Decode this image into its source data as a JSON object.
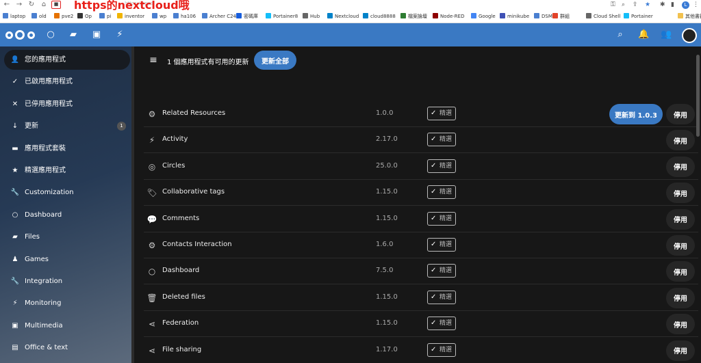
{
  "annotation_text": "https的nextcloud哦",
  "browser": {
    "url": "https://apps",
    "bookmarks": [
      {
        "label": "laptop",
        "color": "#4a7fd0"
      },
      {
        "label": "old",
        "color": "#4a7fd0"
      },
      {
        "label": "pve2",
        "color": "#e57200"
      },
      {
        "label": "Op",
        "color": "#333333"
      },
      {
        "label": "pi",
        "color": "#4a7fd0"
      },
      {
        "label": "inventor",
        "color": "#f0b400"
      },
      {
        "label": "wp",
        "color": "#4a7fd0"
      },
      {
        "label": "ha106",
        "color": "#4a7fd0"
      },
      {
        "label": "Archer C24",
        "color": "#4a7fd0"
      },
      {
        "label": "密碼庫",
        "color": "#175ddc"
      },
      {
        "label": "Portainer8",
        "color": "#13bef9"
      },
      {
        "label": "Hub",
        "color": "#666666"
      },
      {
        "label": "Nextcloud",
        "color": "#0082c9"
      },
      {
        "label": "cloud8888",
        "color": "#0082c9"
      },
      {
        "label": "檔案論壇",
        "color": "#2e7d32"
      },
      {
        "label": "Node-RED",
        "color": "#8f0000"
      },
      {
        "label": "Google",
        "color": "#4285f4"
      },
      {
        "label": "minikube",
        "color": "#3f51b5"
      },
      {
        "label": "DSM",
        "color": "#4a7fd0"
      },
      {
        "label": "群組",
        "color": "#e24329"
      },
      {
        "label": "Cloud Shell",
        "color": "#666666"
      },
      {
        "label": "Portainer",
        "color": "#13bef9"
      },
      {
        "label": "其他書籤",
        "color": "#f2c14e"
      }
    ]
  },
  "header": {
    "icons": [
      "nextcloud-logo",
      "dashboard-icon",
      "files-icon",
      "photos-icon",
      "activity-icon",
      "search-icon",
      "notifications-icon",
      "contacts-icon",
      "avatar"
    ]
  },
  "sidebar": {
    "items": [
      {
        "label": "您的應用程式",
        "icon": "user-icon",
        "glyph": "👤",
        "active": true
      },
      {
        "label": "已啟用應用程式",
        "icon": "check-icon",
        "glyph": "✓"
      },
      {
        "label": "已停用應用程式",
        "icon": "close-icon",
        "glyph": "✕"
      },
      {
        "label": "更新",
        "icon": "download-icon",
        "glyph": "↓",
        "badge": "1"
      },
      {
        "label": "應用程式套裝",
        "icon": "archive-icon",
        "glyph": "▬"
      },
      {
        "label": "精選應用程式",
        "icon": "star-icon",
        "glyph": "★"
      },
      {
        "label": "Customization",
        "icon": "wrench-icon",
        "glyph": "🔧"
      },
      {
        "label": "Dashboard",
        "icon": "circle-icon",
        "glyph": "○"
      },
      {
        "label": "Files",
        "icon": "folder-icon",
        "glyph": "▰"
      },
      {
        "label": "Games",
        "icon": "games-icon",
        "glyph": "♟"
      },
      {
        "label": "Integration",
        "icon": "wrench-icon",
        "glyph": "🔧"
      },
      {
        "label": "Monitoring",
        "icon": "activity-icon",
        "glyph": "⚡"
      },
      {
        "label": "Multimedia",
        "icon": "image-icon",
        "glyph": "▣"
      },
      {
        "label": "Office & text",
        "icon": "document-icon",
        "glyph": "▤"
      }
    ]
  },
  "main": {
    "update_summary": "1 個應用程式有可用的更新",
    "update_all_label": "更新全部",
    "featured_label": "精選",
    "disable_label": "停用",
    "apps": [
      {
        "name": "Related Resources",
        "version": "1.0.0",
        "icon": "gear-icon",
        "glyph": "⚙",
        "update_label": "更新到 1.0.3"
      },
      {
        "name": "Activity",
        "version": "2.17.0",
        "icon": "activity-icon",
        "glyph": "⚡"
      },
      {
        "name": "Circles",
        "version": "25.0.0",
        "icon": "circles-icon",
        "glyph": "◎"
      },
      {
        "name": "Collaborative tags",
        "version": "1.15.0",
        "icon": "tag-icon",
        "glyph": "🏷"
      },
      {
        "name": "Comments",
        "version": "1.15.0",
        "icon": "comment-icon",
        "glyph": "💬"
      },
      {
        "name": "Contacts Interaction",
        "version": "1.6.0",
        "icon": "gear-icon",
        "glyph": "⚙"
      },
      {
        "name": "Dashboard",
        "version": "7.5.0",
        "icon": "circle-icon",
        "glyph": "○"
      },
      {
        "name": "Deleted files",
        "version": "1.15.0",
        "icon": "trash-icon",
        "glyph": "🗑"
      },
      {
        "name": "Federation",
        "version": "1.15.0",
        "icon": "share-icon",
        "glyph": "⋖"
      },
      {
        "name": "File sharing",
        "version": "1.17.0",
        "icon": "share-icon",
        "glyph": "⋖"
      }
    ]
  }
}
